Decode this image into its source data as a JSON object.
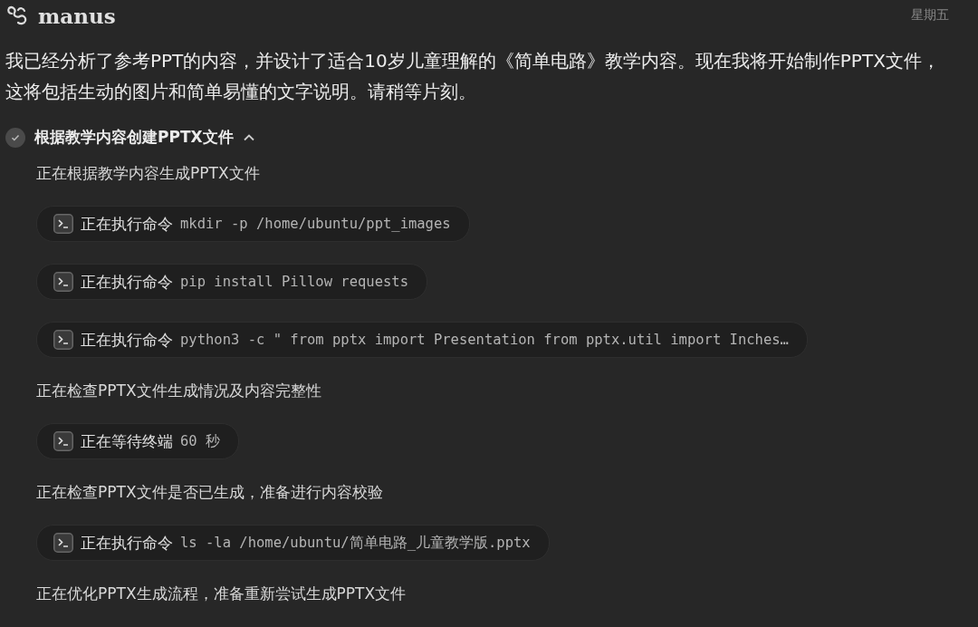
{
  "header": {
    "brand": "manus",
    "day": "星期五"
  },
  "message": "我已经分析了参考PPT的内容，并设计了适合10岁儿童理解的《简单电路》教学内容。现在我将开始制作PPTX文件，这将包括生动的图片和简单易懂的文字说明。请稍等片刻。",
  "task": {
    "title": "根据教学内容创建PPTX文件",
    "done": true,
    "expanded": true,
    "steps": [
      {
        "kind": "text",
        "text": "正在根据教学内容生成PPTX文件"
      },
      {
        "kind": "command",
        "label": "正在执行命令",
        "command": "mkdir -p /home/ubuntu/ppt_images"
      },
      {
        "kind": "command",
        "label": "正在执行命令",
        "command": "pip install Pillow requests"
      },
      {
        "kind": "command",
        "label": "正在执行命令",
        "command": "python3 -c \" from pptx import Presentation from pptx.util import Inches…"
      },
      {
        "kind": "text",
        "text": "正在检查PPTX文件生成情况及内容完整性"
      },
      {
        "kind": "command",
        "label": "正在等待终端",
        "command": "60 秒"
      },
      {
        "kind": "text",
        "text": "正在检查PPTX文件是否已生成，准备进行内容校验"
      },
      {
        "kind": "command",
        "label": "正在执行命令",
        "command": "ls -la /home/ubuntu/简单电路_儿童教学版.pptx"
      },
      {
        "kind": "text",
        "text": "正在优化PPTX生成流程，准备重新尝试生成PPTX文件"
      }
    ]
  }
}
